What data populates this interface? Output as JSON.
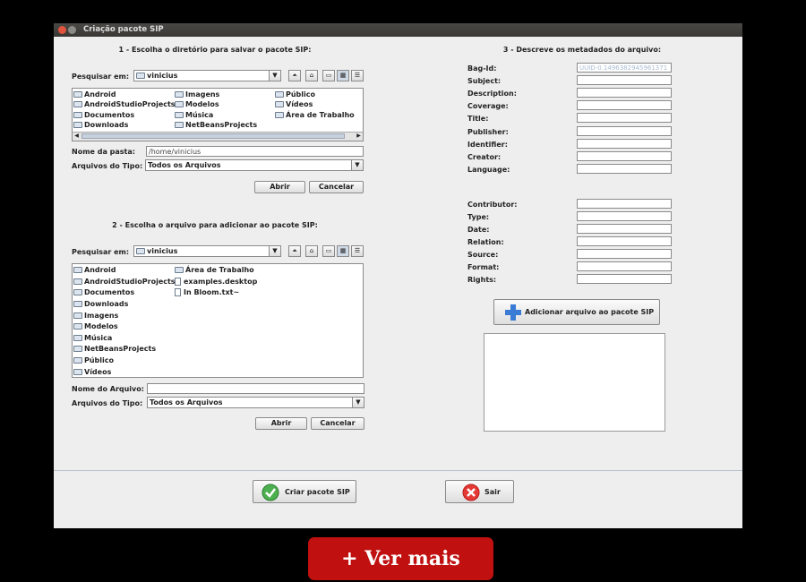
{
  "window": {
    "title": "Criação pacote SIP"
  },
  "section1": {
    "title": "1 - Escolha o diretório para salvar o pacote SIP:",
    "lookin_label": "Pesquisar em:",
    "lookin_value": "vinicius",
    "items": [
      "Android",
      "AndroidStudioProjects",
      "Documentos",
      "Downloads",
      "Imagens",
      "Modelos",
      "Música",
      "NetBeansProjects",
      "Público",
      "Vídeos",
      "Área de Trabalho"
    ],
    "folder_name_label": "Nome da pasta:",
    "folder_name_value": "/home/vinicius",
    "filetype_label": "Arquivos do Tipo:",
    "filetype_value": "Todos os Arquivos",
    "open_label": "Abrir",
    "cancel_label": "Cancelar"
  },
  "section2": {
    "title": "2 - Escolha o arquivo para adicionar ao pacote SIP:",
    "lookin_label": "Pesquisar em:",
    "lookin_value": "vinicius",
    "items": [
      "Android",
      "AndroidStudioProjects",
      "Documentos",
      "Downloads",
      "Imagens",
      "Modelos",
      "Música",
      "NetBeansProjects",
      "Público",
      "Vídeos",
      "Área de Trabalho",
      "examples.desktop",
      "In Bloom.txt~"
    ],
    "filename_label": "Nome do Arquivo:",
    "filename_value": "",
    "filetype_label": "Arquivos do Tipo:",
    "filetype_value": "Todos os Arquivos",
    "open_label": "Abrir",
    "cancel_label": "Cancelar"
  },
  "section3": {
    "title": "3 - Descreve os metadados do arquivo:",
    "bagid_label": "Bag-Id:",
    "bagid_value": "UUID-0.1496382945961371",
    "fields": [
      "Subject:",
      "Description:",
      "Coverage:",
      "Title:",
      "Publisher:",
      "Identifier:",
      "Creator:",
      "Language:"
    ],
    "fields2": [
      "Contributor:",
      "Type:",
      "Date:",
      "Relation:",
      "Source:",
      "Format:",
      "Rights:"
    ],
    "add_button_label": "Adicionar arquivo ao pacote SIP"
  },
  "footer": {
    "create_label": "Criar pacote SIP",
    "exit_label": "Sair"
  },
  "banner": {
    "label": "+ Ver mais"
  },
  "colors": {
    "title_bar": "#3d3b38",
    "window_bg": "#eeeeee",
    "banner": "#c01010",
    "accent_blue": "#3a7bd5"
  }
}
